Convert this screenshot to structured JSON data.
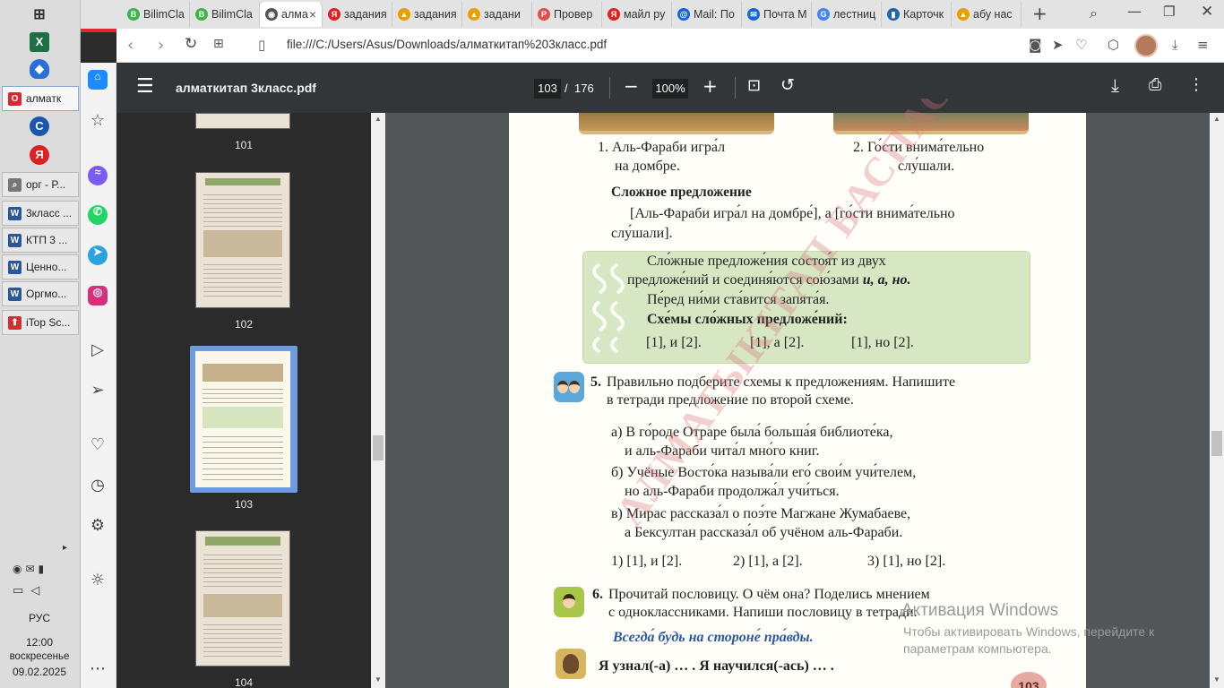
{
  "browser": {
    "tabs": [
      {
        "label": "BilimCla",
        "fav_color": "#3bb54a",
        "fav": "B"
      },
      {
        "label": "BilimCla",
        "fav_color": "#3bb54a",
        "fav": "B"
      },
      {
        "label": "алма",
        "fav_color": "#555555",
        "fav": "◉",
        "active": true
      },
      {
        "label": "задания",
        "fav_color": "#e02020",
        "fav": "Я"
      },
      {
        "label": "задания",
        "fav_color": "#e8a000",
        "fav": "▲"
      },
      {
        "label": "задани",
        "fav_color": "#e8a000",
        "fav": "▲"
      },
      {
        "label": "Провер",
        "fav_color": "#e05050",
        "fav": "P"
      },
      {
        "label": "майл ру",
        "fav_color": "#e02020",
        "fav": "Я"
      },
      {
        "label": "Mail: По",
        "fav_color": "#1166dd",
        "fav": "@"
      },
      {
        "label": "Почта М",
        "fav_color": "#1166dd",
        "fav": "✉"
      },
      {
        "label": "лестниц",
        "fav_color": "#4285f4",
        "fav": "G"
      },
      {
        "label": "Карточк",
        "fav_color": "#2266aa",
        "fav": "▮"
      },
      {
        "label": "абу нас",
        "fav_color": "#e8a000",
        "fav": "▲"
      }
    ],
    "url": "file:///C:/Users/Asus/Downloads/алматкитап%203класс.pdf"
  },
  "pdf": {
    "filename": "алматкитап 3класс.pdf",
    "page_current": "103",
    "page_sep": "/",
    "page_total": "176",
    "zoom": "100%"
  },
  "thumbnails": [
    {
      "num": "101"
    },
    {
      "num": "102"
    },
    {
      "num": "103",
      "selected": true
    },
    {
      "num": "104"
    }
  ],
  "taskbar": {
    "items": [
      {
        "label": "алматк",
        "color": "#e0262e",
        "icon": "O",
        "active": true
      },
      {
        "label": "орг - Р...",
        "color": "#666666",
        "icon": "🔍"
      },
      {
        "label": "3класс ...",
        "color": "#2b579a",
        "icon": "W"
      },
      {
        "label": "КТП 3 ...",
        "color": "#2b579a",
        "icon": "W"
      },
      {
        "label": "Ценно...",
        "color": "#2b579a",
        "icon": "W"
      },
      {
        "label": "Оргмо...",
        "color": "#2b579a",
        "icon": "W"
      },
      {
        "label": "iTop Sc...",
        "color": "#d0302e",
        "icon": "⬆"
      }
    ],
    "lang": "РУС",
    "time": "12:00",
    "day": "воскресенье",
    "date": "09.02.2025"
  },
  "doc": {
    "cap1a": "1. Аль-Фараби игра́л",
    "cap1b": "на домбре.",
    "cap2a": "2. Го́сти внима́тельно",
    "cap2b": "слу́шали.",
    "complex_title": "Сложное предложение",
    "complex_l1": "[Аль-Фараби игра́л на домбре́], а [го́сти внима́тельно",
    "complex_l2": "слу́шали].",
    "rule_l1": "Сло́жные предложе́ния состоя́т из двух",
    "rule_l2a": "предложе́ний и соединя́ются сою́зами ",
    "rule_l2b": "и, а, но.",
    "rule_l3": "Пе́ред ни́ми ста́вится запята́я.",
    "rule_l4": "Схе́мы сло́жных предложе́ний:",
    "rule_s1": "[1], и [2].",
    "rule_s2": "[1], а [2].",
    "rule_s3": "[1], но [2].",
    "ex5_num": "5.",
    "ex5_l1": "Правильно подберите схемы к предложениям. Напишите",
    "ex5_l2": "в тетради предложение по второй схеме.",
    "a1": "а) В го́роде Отраре была́ больша́я библиоте́ка,",
    "a2": "и аль-Фараби чита́л мно́го книг.",
    "b1": "б) Учёные Восто́ка называ́ли его́ свои́м учи́телем,",
    "b2": "но аль-Фараби продолжа́л учи́ться.",
    "c1": "в) Мирас рассказа́л о поэ́те Магжане Жумабаеве,",
    "c2": "а Бексултан рассказа́л об учёном аль-Фараби.",
    "sch1": "1) [1], и [2].",
    "sch2": "2) [1], а [2].",
    "sch3": "3) [1], но [2].",
    "ex6_num": "6.",
    "ex6_l1": "Прочитай пословицу. О чём она? Поделись мнением",
    "ex6_l2": "с одноклассниками. Напиши пословицу в тетради.",
    "proverb": "Всегда́ будь на стороне́ пра́вды.",
    "learned": "Я узнал(-а) … . Я научился(-ась) … .",
    "page_badge": "103",
    "watermark": "АЛМАТЫКІТАП БАСПАСЫ"
  },
  "windows_activation": {
    "title": "Активация Windows",
    "text": "Чтобы активировать Windows, перейдите к параметрам компьютера."
  }
}
